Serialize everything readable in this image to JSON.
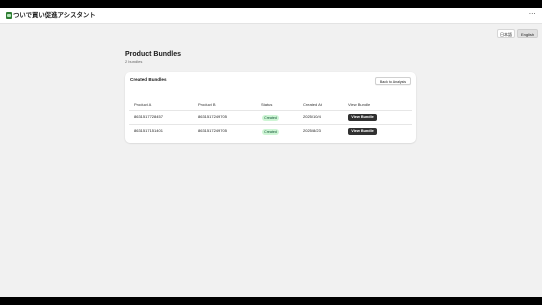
{
  "app": {
    "title": "ついで買い促進アシスタント",
    "more_label": "⋯"
  },
  "language": {
    "ja_label": "日本語",
    "en_label": "English"
  },
  "page": {
    "title": "Product Bundles",
    "subtitle": "2 bundles"
  },
  "card": {
    "title": "Created Bundles",
    "back_label": "Back to Analysis"
  },
  "table": {
    "headers": [
      "Product A",
      "Product B",
      "Status",
      "Created At",
      "View Bundle"
    ],
    "rows": [
      {
        "product_a": "8631517728457",
        "product_b": "8631517249705",
        "status": "Created",
        "created_at": "2025/10/4",
        "action": "View Bundle"
      },
      {
        "product_a": "8631517151401",
        "product_b": "8631517249705",
        "status": "Created",
        "created_at": "2025/8/23",
        "action": "View Bundle"
      }
    ]
  },
  "colors": {
    "status_badge_bg": "#cdf5d4",
    "primary_button": "#303030",
    "app_icon": "#2e7d32"
  }
}
